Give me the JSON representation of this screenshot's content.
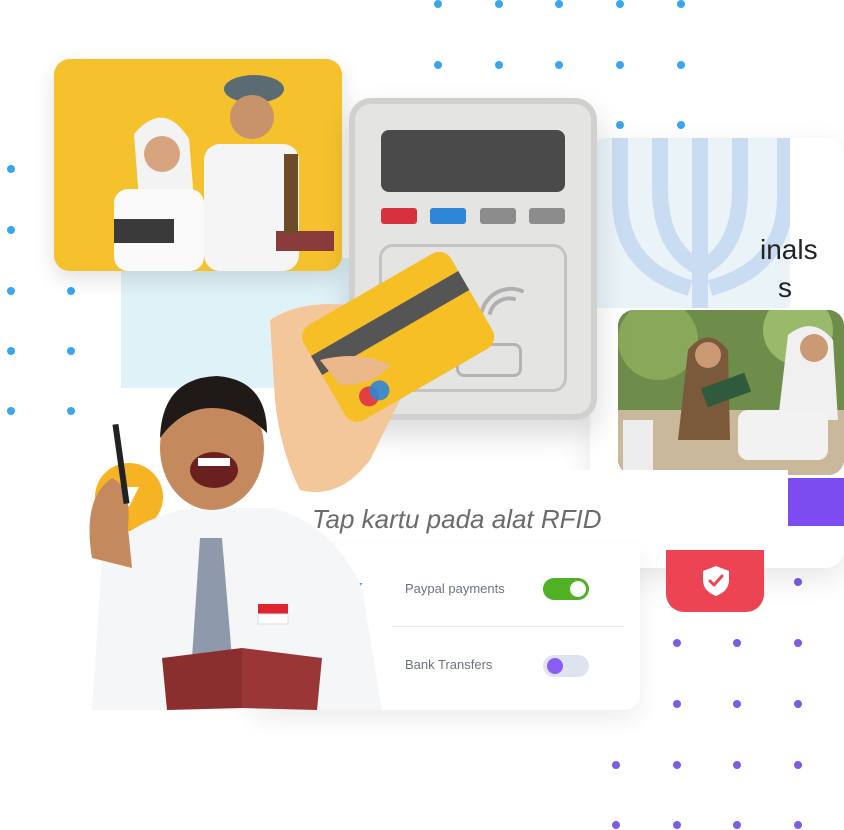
{
  "caption": "Tap kartu pada alat RFID",
  "partial_heading": {
    "line1": "inals",
    "line2": "s"
  },
  "payments": [
    {
      "label": "Paypal payments",
      "enabled": true
    },
    {
      "label": "Bank Transfers",
      "enabled": false
    }
  ],
  "colors": {
    "accent_purple": "#7c4cf0",
    "toggle_on": "#4fb123",
    "toggle_off_bg": "#dde4ef",
    "toggle_off_knob": "#8a5cf5",
    "shield_red": "#ec4452",
    "dot_blue": "#3aa6ee",
    "dot_purple": "#7c5ce6",
    "card_yellow": "#f6bf26",
    "photo_bg_yellow": "#f5c22e"
  },
  "icons": {
    "shield": "shield-check-icon",
    "terminal": "payment-terminal-icon",
    "card": "credit-card-icon",
    "contactless": "contactless-icon"
  },
  "images": {
    "top_left_photo": "students-thumbs-up-photo",
    "right_photo": "students-outdoor-photo",
    "person": "student-with-pen-and-book"
  }
}
